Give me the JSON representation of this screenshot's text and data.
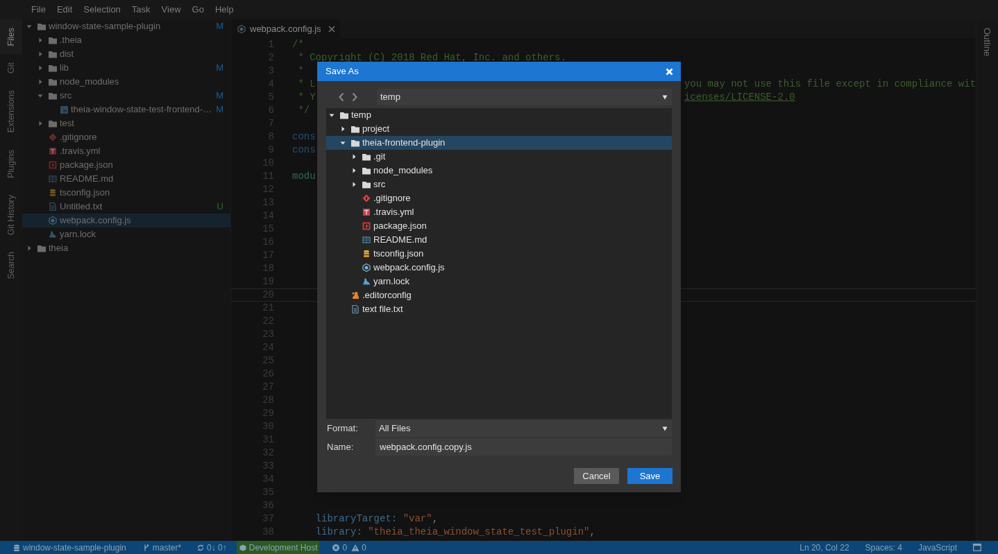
{
  "menu": [
    "File",
    "Edit",
    "Selection",
    "Task",
    "View",
    "Go",
    "Help"
  ],
  "activity_tabs": [
    {
      "label": "Files",
      "selected": true
    },
    {
      "label": "Git",
      "selected": false
    },
    {
      "label": "Extensions",
      "selected": false
    },
    {
      "label": "Plugins",
      "selected": false
    },
    {
      "label": "Git History",
      "selected": false
    },
    {
      "label": "Search",
      "selected": false
    }
  ],
  "file_tree": [
    {
      "name": "window-state-sample-plugin",
      "kind": "folder",
      "expanded": true,
      "selected": false,
      "git": "M",
      "children": [
        {
          "name": ".theia",
          "kind": "folder",
          "expanded": false,
          "selected": false
        },
        {
          "name": "dist",
          "kind": "folder",
          "expanded": false,
          "selected": false
        },
        {
          "name": "lib",
          "kind": "folder",
          "expanded": false,
          "selected": false,
          "git": "M"
        },
        {
          "name": "node_modules",
          "kind": "folder",
          "expanded": false,
          "selected": false
        },
        {
          "name": "src",
          "kind": "folder",
          "expanded": true,
          "selected": false,
          "git": "M",
          "children": [
            {
              "name": "theia-window-state-test-frontend-…",
              "kind": "ts",
              "selected": false,
              "git": "M"
            }
          ]
        },
        {
          "name": "test",
          "kind": "folder",
          "expanded": false,
          "selected": false
        },
        {
          "name": ".gitignore",
          "kind": "git",
          "selected": false
        },
        {
          "name": ".travis.yml",
          "kind": "travis",
          "selected": false
        },
        {
          "name": "package.json",
          "kind": "npm",
          "selected": false
        },
        {
          "name": "README.md",
          "kind": "readme",
          "selected": false
        },
        {
          "name": "tsconfig.json",
          "kind": "db",
          "selected": false
        },
        {
          "name": "Untitled.txt",
          "kind": "text",
          "selected": false,
          "git": "U"
        },
        {
          "name": "webpack.config.js",
          "kind": "webpack",
          "selected": true
        },
        {
          "name": "yarn.lock",
          "kind": "yarn",
          "selected": false
        }
      ]
    },
    {
      "name": "theia",
      "kind": "folder",
      "expanded": false,
      "selected": false
    }
  ],
  "editor_tab": {
    "label": "webpack.config.js",
    "kind": "webpack"
  },
  "lines": [
    {
      "number": "1",
      "current": false,
      "left": [
        {
          "text": "/*",
          "kind": "comment"
        }
      ]
    },
    {
      "number": "2",
      "current": false,
      "left": [
        {
          "text": " * Copyright (C) 2018 Red Hat, Inc. and others.",
          "kind": "comment"
        }
      ]
    },
    {
      "number": "3",
      "current": false,
      "left": [
        {
          "text": " *",
          "kind": "comment"
        }
      ]
    },
    {
      "number": "4",
      "current": false,
      "left": [
        {
          "text": " * L",
          "kind": "comment"
        }
      ],
      "right": [
        {
          "text": "you may not use this file except in compliance wit",
          "kind": "comment"
        }
      ]
    },
    {
      "number": "5",
      "current": false,
      "left": [
        {
          "text": " * Y",
          "kind": "comment"
        }
      ],
      "right": [
        {
          "text": "icenses/LICENSE-2.0",
          "kind": "link"
        }
      ]
    },
    {
      "number": "6",
      "current": false,
      "left": [
        {
          "text": " */",
          "kind": "comment"
        }
      ]
    },
    {
      "number": "7",
      "current": false
    },
    {
      "number": "8",
      "current": false,
      "left": [
        {
          "text": "cons",
          "kind": "keyword"
        }
      ]
    },
    {
      "number": "9",
      "current": false,
      "left": [
        {
          "text": "cons",
          "kind": "keyword"
        }
      ]
    },
    {
      "number": "10",
      "current": false
    },
    {
      "number": "11",
      "current": false,
      "left": [
        {
          "text": "modu",
          "kind": "type"
        }
      ]
    },
    {
      "number": "12",
      "current": false
    },
    {
      "number": "13",
      "current": false
    },
    {
      "number": "14",
      "current": false
    },
    {
      "number": "15",
      "current": false
    },
    {
      "number": "16",
      "current": false
    },
    {
      "number": "17",
      "current": false
    },
    {
      "number": "18",
      "current": false
    },
    {
      "number": "19",
      "current": false
    },
    {
      "number": "20",
      "current": true
    },
    {
      "number": "21",
      "current": false
    },
    {
      "number": "22",
      "current": false
    },
    {
      "number": "23",
      "current": false
    },
    {
      "number": "24",
      "current": false
    },
    {
      "number": "25",
      "current": false
    },
    {
      "number": "26",
      "current": false
    },
    {
      "number": "27",
      "current": false
    },
    {
      "number": "28",
      "current": false
    },
    {
      "number": "29",
      "current": false
    },
    {
      "number": "30",
      "current": false
    },
    {
      "number": "31",
      "current": false
    },
    {
      "number": "32",
      "current": false
    },
    {
      "number": "33",
      "current": false
    },
    {
      "number": "34",
      "current": false
    },
    {
      "number": "35",
      "current": false
    },
    {
      "number": "36",
      "current": false
    },
    {
      "number": "37",
      "current": false,
      "left": [
        {
          "text": "    libraryTarget: ",
          "kind": "property"
        },
        {
          "text": "\"var\"",
          "kind": "string"
        },
        {
          "text": ",",
          "kind": "plain"
        }
      ]
    },
    {
      "number": "38",
      "current": false,
      "left": [
        {
          "text": "    library: ",
          "kind": "property"
        },
        {
          "text": "\"theia_theia_window_state_test_plugin\"",
          "kind": "string"
        },
        {
          "text": ",",
          "kind": "plain"
        }
      ]
    }
  ],
  "outline_tab": {
    "label": "Outline"
  },
  "dialog": {
    "title": "Save As",
    "location": "temp",
    "tree": [
      {
        "name": "temp",
        "kind": "folder",
        "expanded": true,
        "selected": false,
        "children": [
          {
            "name": "project",
            "kind": "folder",
            "expanded": false,
            "selected": false
          },
          {
            "name": "theia-frontend-plugin",
            "kind": "folder",
            "expanded": true,
            "selected": true,
            "children": [
              {
                "name": ".git",
                "kind": "folder",
                "expanded": false,
                "selected": false
              },
              {
                "name": "node_modules",
                "kind": "folder",
                "expanded": false,
                "selected": false
              },
              {
                "name": "src",
                "kind": "folder",
                "expanded": false,
                "selected": false
              },
              {
                "name": ".gitignore",
                "kind": "git",
                "selected": false
              },
              {
                "name": ".travis.yml",
                "kind": "travis",
                "selected": false
              },
              {
                "name": "package.json",
                "kind": "npm",
                "selected": false
              },
              {
                "name": "README.md",
                "kind": "readme",
                "selected": false
              },
              {
                "name": "tsconfig.json",
                "kind": "db",
                "selected": false
              },
              {
                "name": "webpack.config.js",
                "kind": "webpack",
                "selected": false
              },
              {
                "name": "yarn.lock",
                "kind": "yarn",
                "selected": false
              }
            ]
          },
          {
            "name": ".editorconfig",
            "kind": "config",
            "selected": false
          },
          {
            "name": "text file.txt",
            "kind": "text",
            "selected": false
          }
        ]
      }
    ],
    "format_label": "Format:",
    "format": "All Files",
    "name_label": "Name:",
    "name": "webpack.config.copy.js",
    "buttons": [
      {
        "label": "Cancel",
        "kind": "secondary"
      },
      {
        "label": "Save",
        "kind": "primary"
      }
    ]
  },
  "status_bar": {
    "left": [
      {
        "kind": "repo",
        "text": "window-state-sample-plugin"
      },
      {
        "kind": "branch",
        "text": "master*"
      },
      {
        "kind": "sync",
        "text": "0↓ 0↑"
      },
      {
        "kind": "host",
        "text": "Development Host"
      },
      {
        "kind": "errors",
        "text": "0"
      },
      {
        "kind": "warnings",
        "text": "0"
      }
    ],
    "right": [
      {
        "text": "Ln 20, Col 22"
      },
      {
        "text": "Spaces: 4"
      },
      {
        "text": "JavaScript"
      }
    ]
  }
}
